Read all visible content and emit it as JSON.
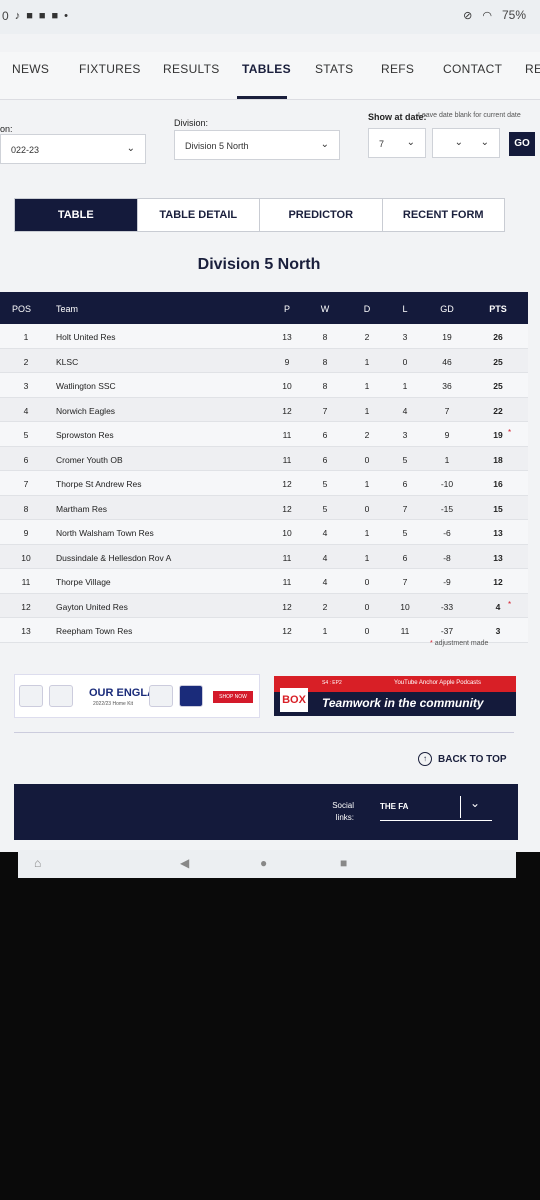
{
  "status": {
    "left_text": "0",
    "battery": "75%",
    "colors": {
      "bar": "#eceff2"
    }
  },
  "nav": {
    "items": [
      "NEWS",
      "FIXTURES",
      "RESULTS",
      "TABLES",
      "STATS",
      "REFS",
      "CONTACT",
      "RE"
    ],
    "active": "TABLES"
  },
  "filters": {
    "season_label": "on:",
    "season_value": "022-23",
    "division_label": "Division:",
    "division_value": "Division 5 North",
    "date_label": "Show at date:",
    "date_hint": "Leave date blank for current date",
    "date_day": "7",
    "go_label": "GO"
  },
  "tabs": [
    "TABLE",
    "TABLE DETAIL",
    "PREDICTOR",
    "RECENT FORM"
  ],
  "table_title": "Division 5 North",
  "columns": {
    "pos": "POS",
    "team": "Team",
    "p": "P",
    "w": "W",
    "d": "D",
    "l": "L",
    "gd": "GD",
    "pts": "PTS"
  },
  "rows": [
    {
      "pos": "1",
      "team": "Holt United Res",
      "p": "13",
      "w": "8",
      "d": "2",
      "l": "3",
      "gd": "19",
      "pts": "26",
      "adj": ""
    },
    {
      "pos": "2",
      "team": "KLSC",
      "p": "9",
      "w": "8",
      "d": "1",
      "l": "0",
      "gd": "46",
      "pts": "25",
      "adj": ""
    },
    {
      "pos": "3",
      "team": "Watlington SSC",
      "p": "10",
      "w": "8",
      "d": "1",
      "l": "1",
      "gd": "36",
      "pts": "25",
      "adj": ""
    },
    {
      "pos": "4",
      "team": "Norwich Eagles",
      "p": "12",
      "w": "7",
      "d": "1",
      "l": "4",
      "gd": "7",
      "pts": "22",
      "adj": ""
    },
    {
      "pos": "5",
      "team": "Sprowston Res",
      "p": "11",
      "w": "6",
      "d": "2",
      "l": "3",
      "gd": "9",
      "pts": "19",
      "adj": "*"
    },
    {
      "pos": "6",
      "team": "Cromer Youth OB",
      "p": "11",
      "w": "6",
      "d": "0",
      "l": "5",
      "gd": "1",
      "pts": "18",
      "adj": ""
    },
    {
      "pos": "7",
      "team": "Thorpe St Andrew Res",
      "p": "12",
      "w": "5",
      "d": "1",
      "l": "6",
      "gd": "-10",
      "pts": "16",
      "adj": ""
    },
    {
      "pos": "8",
      "team": "Martham Res",
      "p": "12",
      "w": "5",
      "d": "0",
      "l": "7",
      "gd": "-15",
      "pts": "15",
      "adj": ""
    },
    {
      "pos": "9",
      "team": "North Walsham Town Res",
      "p": "10",
      "w": "4",
      "d": "1",
      "l": "5",
      "gd": "-6",
      "pts": "13",
      "adj": ""
    },
    {
      "pos": "10",
      "team": "Dussindale & Hellesdon Rov A",
      "p": "11",
      "w": "4",
      "d": "1",
      "l": "6",
      "gd": "-8",
      "pts": "13",
      "adj": ""
    },
    {
      "pos": "11",
      "team": "Thorpe Village",
      "p": "11",
      "w": "4",
      "d": "0",
      "l": "7",
      "gd": "-9",
      "pts": "12",
      "adj": ""
    },
    {
      "pos": "12",
      "team": "Gayton United Res",
      "p": "12",
      "w": "2",
      "d": "0",
      "l": "10",
      "gd": "-33",
      "pts": "4",
      "adj": "*"
    },
    {
      "pos": "13",
      "team": "Reepham Town Res",
      "p": "12",
      "w": "1",
      "d": "0",
      "l": "11",
      "gd": "-37",
      "pts": "3",
      "adj": ""
    }
  ],
  "adjustment_note": "adjustment made",
  "ads": {
    "left_title": "OUR ENGLAND",
    "left_sub": "2022/23 Home Kit",
    "left_cta": "SHOP NOW",
    "right_box": "BOX",
    "right_ep": "S4 : EP2",
    "right_platforms": "YouTube  Anchor  Apple Podcasts",
    "right_slogan": "Teamwork in the community"
  },
  "back_to_top": "BACK TO TOP",
  "footer": {
    "social_label": "Social links:",
    "fa_label": "THE FA"
  }
}
